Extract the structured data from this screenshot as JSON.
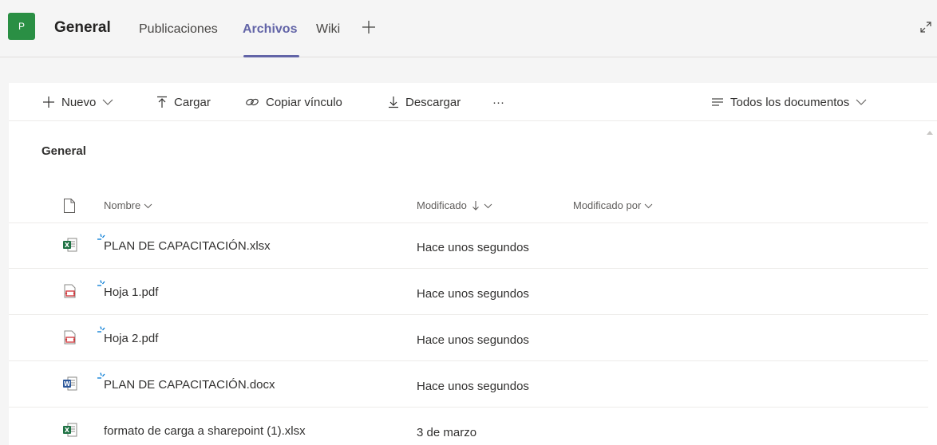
{
  "header": {
    "avatar_letter": "P",
    "team_name": "General",
    "tabs": [
      {
        "label": "Publicaciones",
        "active": false
      },
      {
        "label": "Archivos",
        "active": true
      },
      {
        "label": "Wiki",
        "active": false
      }
    ],
    "add_tab_icon": "plus-icon",
    "expand_icon": "expand-icon",
    "accent_color": "#6264a7",
    "avatar_color": "#2a8f44"
  },
  "toolbar": {
    "nuevo": "Nuevo",
    "cargar": "Cargar",
    "copiar": "Copiar vínculo",
    "descargar": "Descargar",
    "more": "···",
    "view": "Todos los documentos"
  },
  "library": {
    "folder_title": "General",
    "columns": {
      "name": "Nombre",
      "modified": "Modificado",
      "modified_by": "Modificado por"
    },
    "files": [
      {
        "name": "PLAN DE CAPACITACIÓN.xlsx",
        "modified": "Hace unos segundos",
        "type": "excel",
        "new": true
      },
      {
        "name": "Hoja 1.pdf",
        "modified": "Hace unos segundos",
        "type": "pdf",
        "new": true
      },
      {
        "name": "Hoja 2.pdf",
        "modified": "Hace unos segundos",
        "type": "pdf",
        "new": true
      },
      {
        "name": "PLAN DE CAPACITACIÓN.docx",
        "modified": "Hace unos segundos",
        "type": "word",
        "new": true
      },
      {
        "name": "formato de carga a sharepoint (1).xlsx",
        "modified": "3 de marzo",
        "type": "excel",
        "new": false
      }
    ]
  }
}
